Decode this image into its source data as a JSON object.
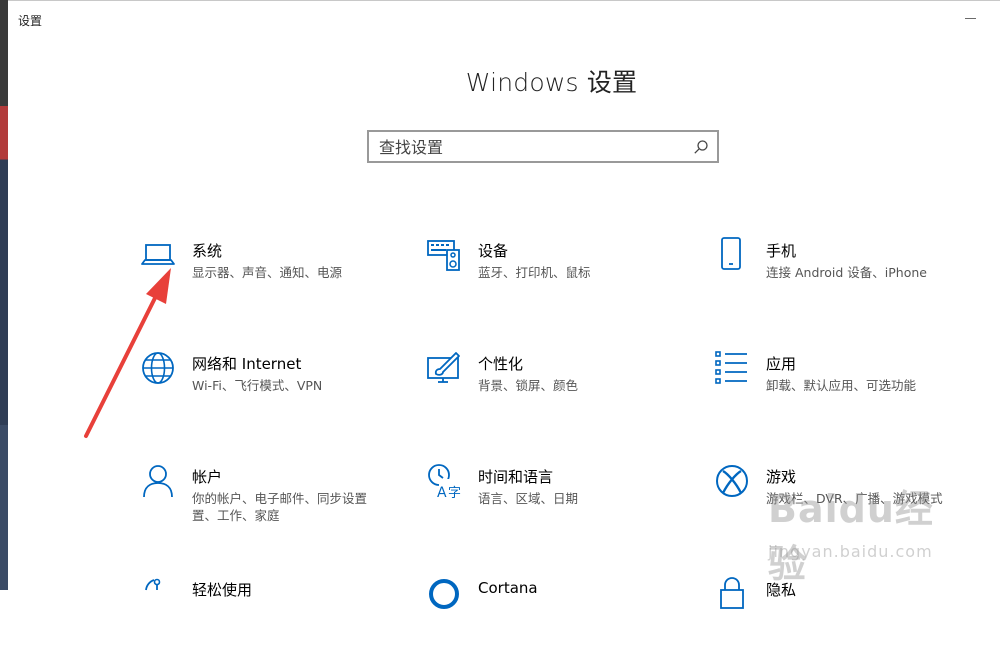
{
  "window": {
    "title": "设置"
  },
  "header": {
    "title": "Windows 设置"
  },
  "search": {
    "placeholder": "查找设置"
  },
  "tiles": [
    {
      "title": "系统",
      "desc": "显示器、声音、通知、电源",
      "icon": "laptop-icon"
    },
    {
      "title": "设备",
      "desc": "蓝牙、打印机、鼠标",
      "icon": "devices-icon"
    },
    {
      "title": "手机",
      "desc": "连接 Android 设备、iPhone",
      "icon": "phone-icon"
    },
    {
      "title": "网络和 Internet",
      "desc": "Wi-Fi、飞行模式、VPN",
      "icon": "globe-icon"
    },
    {
      "title": "个性化",
      "desc": "背景、锁屏、颜色",
      "icon": "personalization-icon"
    },
    {
      "title": "应用",
      "desc": "卸载、默认应用、可选功能",
      "icon": "apps-list-icon"
    },
    {
      "title": "帐户",
      "desc": "你的帐户、电子邮件、同步设置",
      "desc2": "置、工作、家庭",
      "icon": "person-icon"
    },
    {
      "title": "时间和语言",
      "desc": "语言、区域、日期",
      "icon": "time-language-icon"
    },
    {
      "title": "游戏",
      "desc": "游戏栏、DVR、广播、游戏模式",
      "icon": "xbox-icon"
    },
    {
      "title": "轻松使用",
      "desc": "",
      "icon": "ease-of-access-icon"
    },
    {
      "title": "Cortana",
      "desc": "",
      "icon": "cortana-icon"
    },
    {
      "title": "隐私",
      "desc": "",
      "icon": "lock-icon"
    }
  ],
  "watermark": {
    "brand": "Baidu经验",
    "url": "jingyan.baidu.com"
  },
  "colors": {
    "accent": "#0067c0",
    "arrow": "#e8403a"
  }
}
